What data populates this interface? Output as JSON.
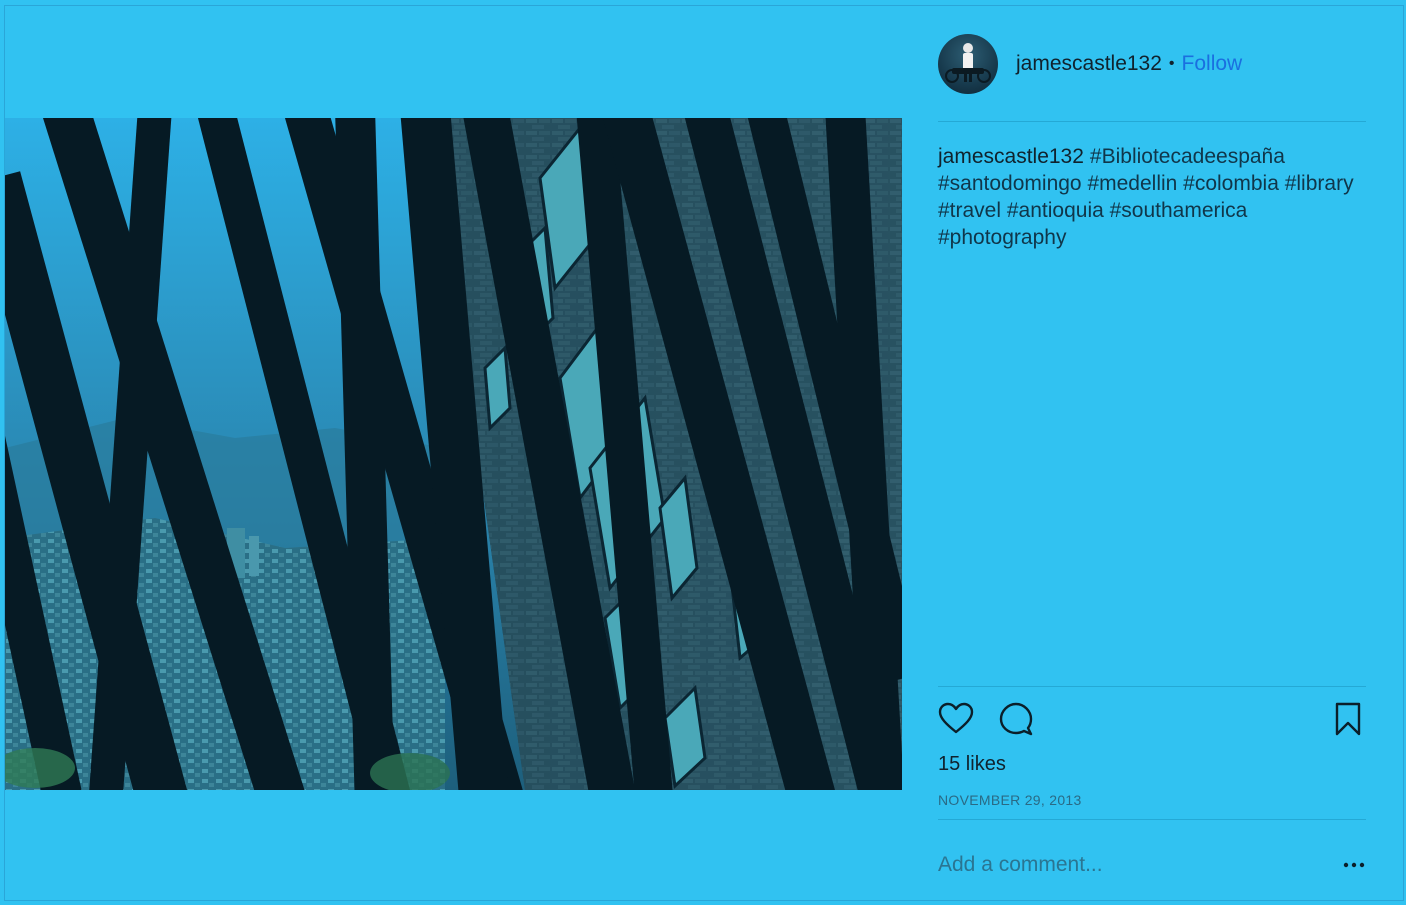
{
  "post": {
    "username": "jamescastle132",
    "separator": "•",
    "follow_label": "Follow",
    "caption_user": "jamescastle132",
    "caption_text": "#Bibliotecadeespaña #santodomingo #medellin #colombia #library #travel #antioquia #southamerica #photography",
    "likes": "15 likes",
    "date": "NOVEMBER 29, 2013"
  },
  "actions": {
    "like_icon": "heart-icon",
    "comment_icon": "comment-icon",
    "save_icon": "bookmark-icon"
  },
  "comment": {
    "placeholder": "Add a comment...",
    "more_icon": "more-options-icon"
  },
  "colors": {
    "background": "#31c2f1",
    "follow": "#1a6fe0"
  }
}
